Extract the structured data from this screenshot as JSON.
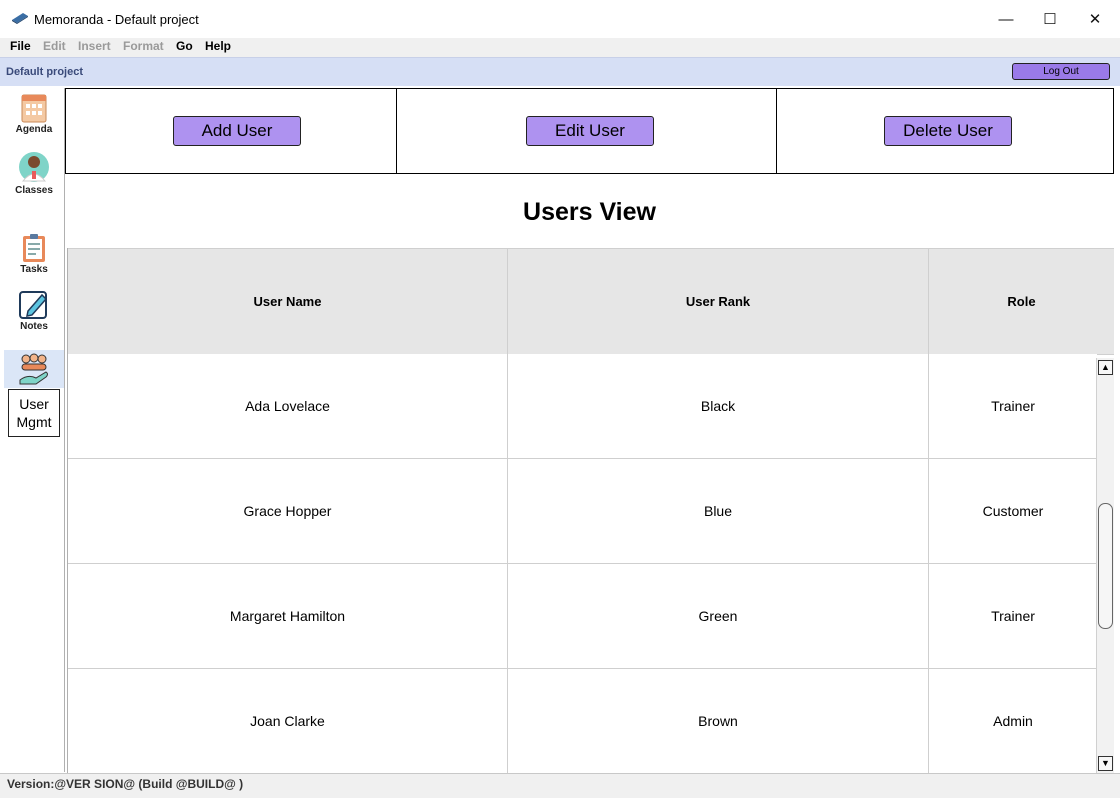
{
  "window": {
    "title": "Memoranda - Default project",
    "minimize": "—",
    "maximize": "☐",
    "close": "✕"
  },
  "menu": [
    "File",
    "Edit",
    "Insert",
    "Format",
    "Go",
    "Help"
  ],
  "menu_disabled": [
    false,
    true,
    true,
    true,
    false,
    false
  ],
  "project": {
    "name": "Default project",
    "logout_label": "Log Out"
  },
  "sidebar": {
    "items": [
      {
        "label": "Agenda",
        "icon": "agenda-icon"
      },
      {
        "label": "Classes",
        "icon": "classes-icon"
      },
      {
        "label": "Tasks",
        "icon": "tasks-icon"
      },
      {
        "label": "Notes",
        "icon": "notes-icon"
      },
      {
        "label": "User Mgmt",
        "label_line1": "User",
        "label_line2": "Mgmt",
        "icon": "user-mgmt-icon"
      }
    ]
  },
  "actions": {
    "add": "Add User",
    "edit": "Edit User",
    "delete": "Delete User"
  },
  "view_title": "Users View",
  "table": {
    "columns": [
      "User Name",
      "User Rank",
      "Role"
    ],
    "rows": [
      [
        "Ada Lovelace",
        "Black",
        "Trainer"
      ],
      [
        "Grace Hopper",
        "Blue",
        "Customer"
      ],
      [
        "Margaret Hamilton",
        "Green",
        "Trainer"
      ],
      [
        "Joan Clarke",
        "Brown",
        "Admin"
      ]
    ]
  },
  "status": {
    "text": "Version:@VER SION@ (Build @BUILD@ )"
  },
  "colors": {
    "button": "#ae92f0",
    "logout": "#9a7ae8",
    "project_bar": "#d6dff5",
    "header_bg": "#e6e6e6"
  }
}
